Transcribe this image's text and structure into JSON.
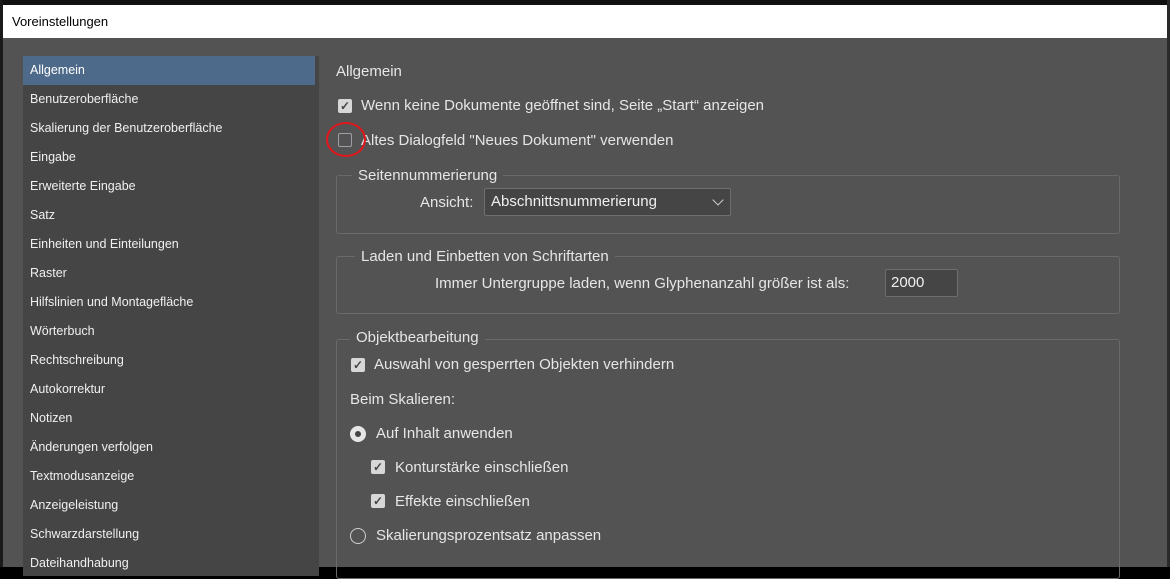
{
  "window": {
    "title": "Voreinstellungen"
  },
  "sidebar": {
    "items": [
      {
        "label": "Allgemein",
        "selected": true
      },
      {
        "label": "Benutzeroberfläche"
      },
      {
        "label": "Skalierung der Benutzeroberfläche"
      },
      {
        "label": "Eingabe"
      },
      {
        "label": "Erweiterte Eingabe"
      },
      {
        "label": "Satz"
      },
      {
        "label": "Einheiten und Einteilungen"
      },
      {
        "label": "Raster"
      },
      {
        "label": "Hilfslinien und Montagefläche"
      },
      {
        "label": "Wörterbuch"
      },
      {
        "label": "Rechtschreibung"
      },
      {
        "label": "Autokorrektur"
      },
      {
        "label": "Notizen"
      },
      {
        "label": "Änderungen verfolgen"
      },
      {
        "label": "Textmodusanzeige"
      },
      {
        "label": "Anzeigeleistung"
      },
      {
        "label": "Schwarzdarstellung"
      },
      {
        "label": "Dateihandhabung"
      }
    ]
  },
  "main": {
    "title": "Allgemein",
    "show_start": {
      "label": "Wenn keine Dokumente geöffnet sind, Seite „Start“ anzeigen",
      "checked": true
    },
    "legacy_new_doc": {
      "label": "Altes Dialogfeld \"Neues Dokument\" verwenden",
      "checked": false
    },
    "page_numbering": {
      "legend": "Seitennummerierung",
      "view_label": "Ansicht:",
      "view_value": "Abschnittsnummerierung"
    },
    "fonts": {
      "legend": "Laden und Einbetten von Schriftarten",
      "subset_label": "Immer Untergruppe laden, wenn Glyphenanzahl größer ist als:",
      "subset_value": "2000"
    },
    "object_editing": {
      "legend": "Objektbearbeitung",
      "prevent_locked": {
        "label": "Auswahl von gesperrten Objekten verhindern",
        "checked": true
      },
      "scaling_label": "Beim Skalieren:",
      "apply_content": {
        "label": "Auf Inhalt anwenden",
        "selected": true
      },
      "include_stroke": {
        "label": "Konturstärke einschließen",
        "checked": true
      },
      "include_effects": {
        "label": "Effekte einschließen",
        "checked": true
      },
      "adjust_percent": {
        "label": "Skalierungsprozentsatz anpassen",
        "selected": false
      }
    }
  },
  "colors": {
    "dialog_bg": "#535353",
    "sidebar_bg": "#454545",
    "selected_bg": "#4e6a8a",
    "annotation": "#e5161c"
  }
}
